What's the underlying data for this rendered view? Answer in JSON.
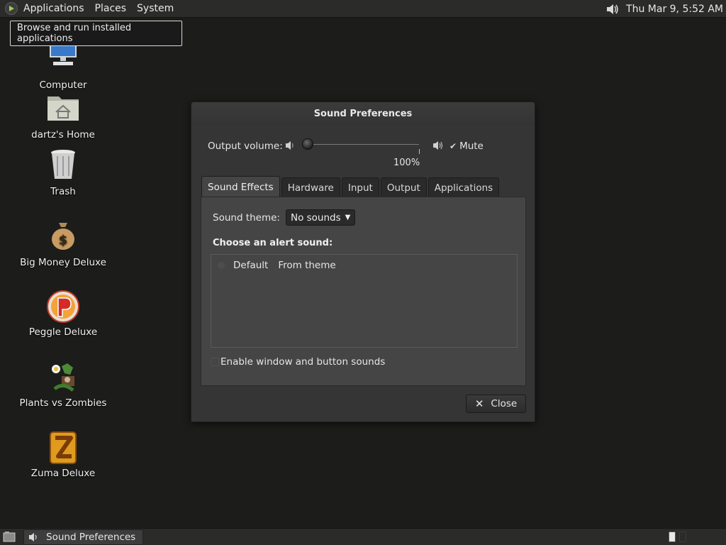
{
  "top_panel": {
    "menus": [
      "Applications",
      "Places",
      "System"
    ],
    "clock": "Thu Mar  9,  5:52 AM",
    "tooltip": "Browse and run installed applications"
  },
  "desktop": {
    "icons": [
      {
        "label": "Computer",
        "icon": "computer-icon"
      },
      {
        "label": "dartz's Home",
        "icon": "home-folder-icon"
      },
      {
        "label": "Trash",
        "icon": "trash-icon"
      },
      {
        "label": "Big Money Deluxe",
        "icon": "money-bag-icon"
      },
      {
        "label": "Peggle Deluxe",
        "icon": "peggle-icon"
      },
      {
        "label": "Plants vs Zombies",
        "icon": "plants-vs-zombies-icon"
      },
      {
        "label": "Zuma Deluxe",
        "icon": "zuma-icon"
      }
    ]
  },
  "dialog": {
    "title": "Sound Preferences",
    "output_volume_label": "Output volume:",
    "volume_percent_text": "100%",
    "volume_level": 0.0,
    "mute_label": "Mute",
    "mute_checked": true,
    "tabs": [
      "Sound Effects",
      "Hardware",
      "Input",
      "Output",
      "Applications"
    ],
    "active_tab": "Sound Effects",
    "sound_theme_label": "Sound theme:",
    "sound_theme_value": "No sounds",
    "alert_heading": "Choose an alert sound:",
    "alert_sounds": [
      {
        "name": "Default",
        "source": "From theme"
      }
    ],
    "enable_sounds_label": "Enable window and button sounds",
    "close_label": "Close"
  },
  "bottom_panel": {
    "task_label": "Sound Preferences"
  }
}
